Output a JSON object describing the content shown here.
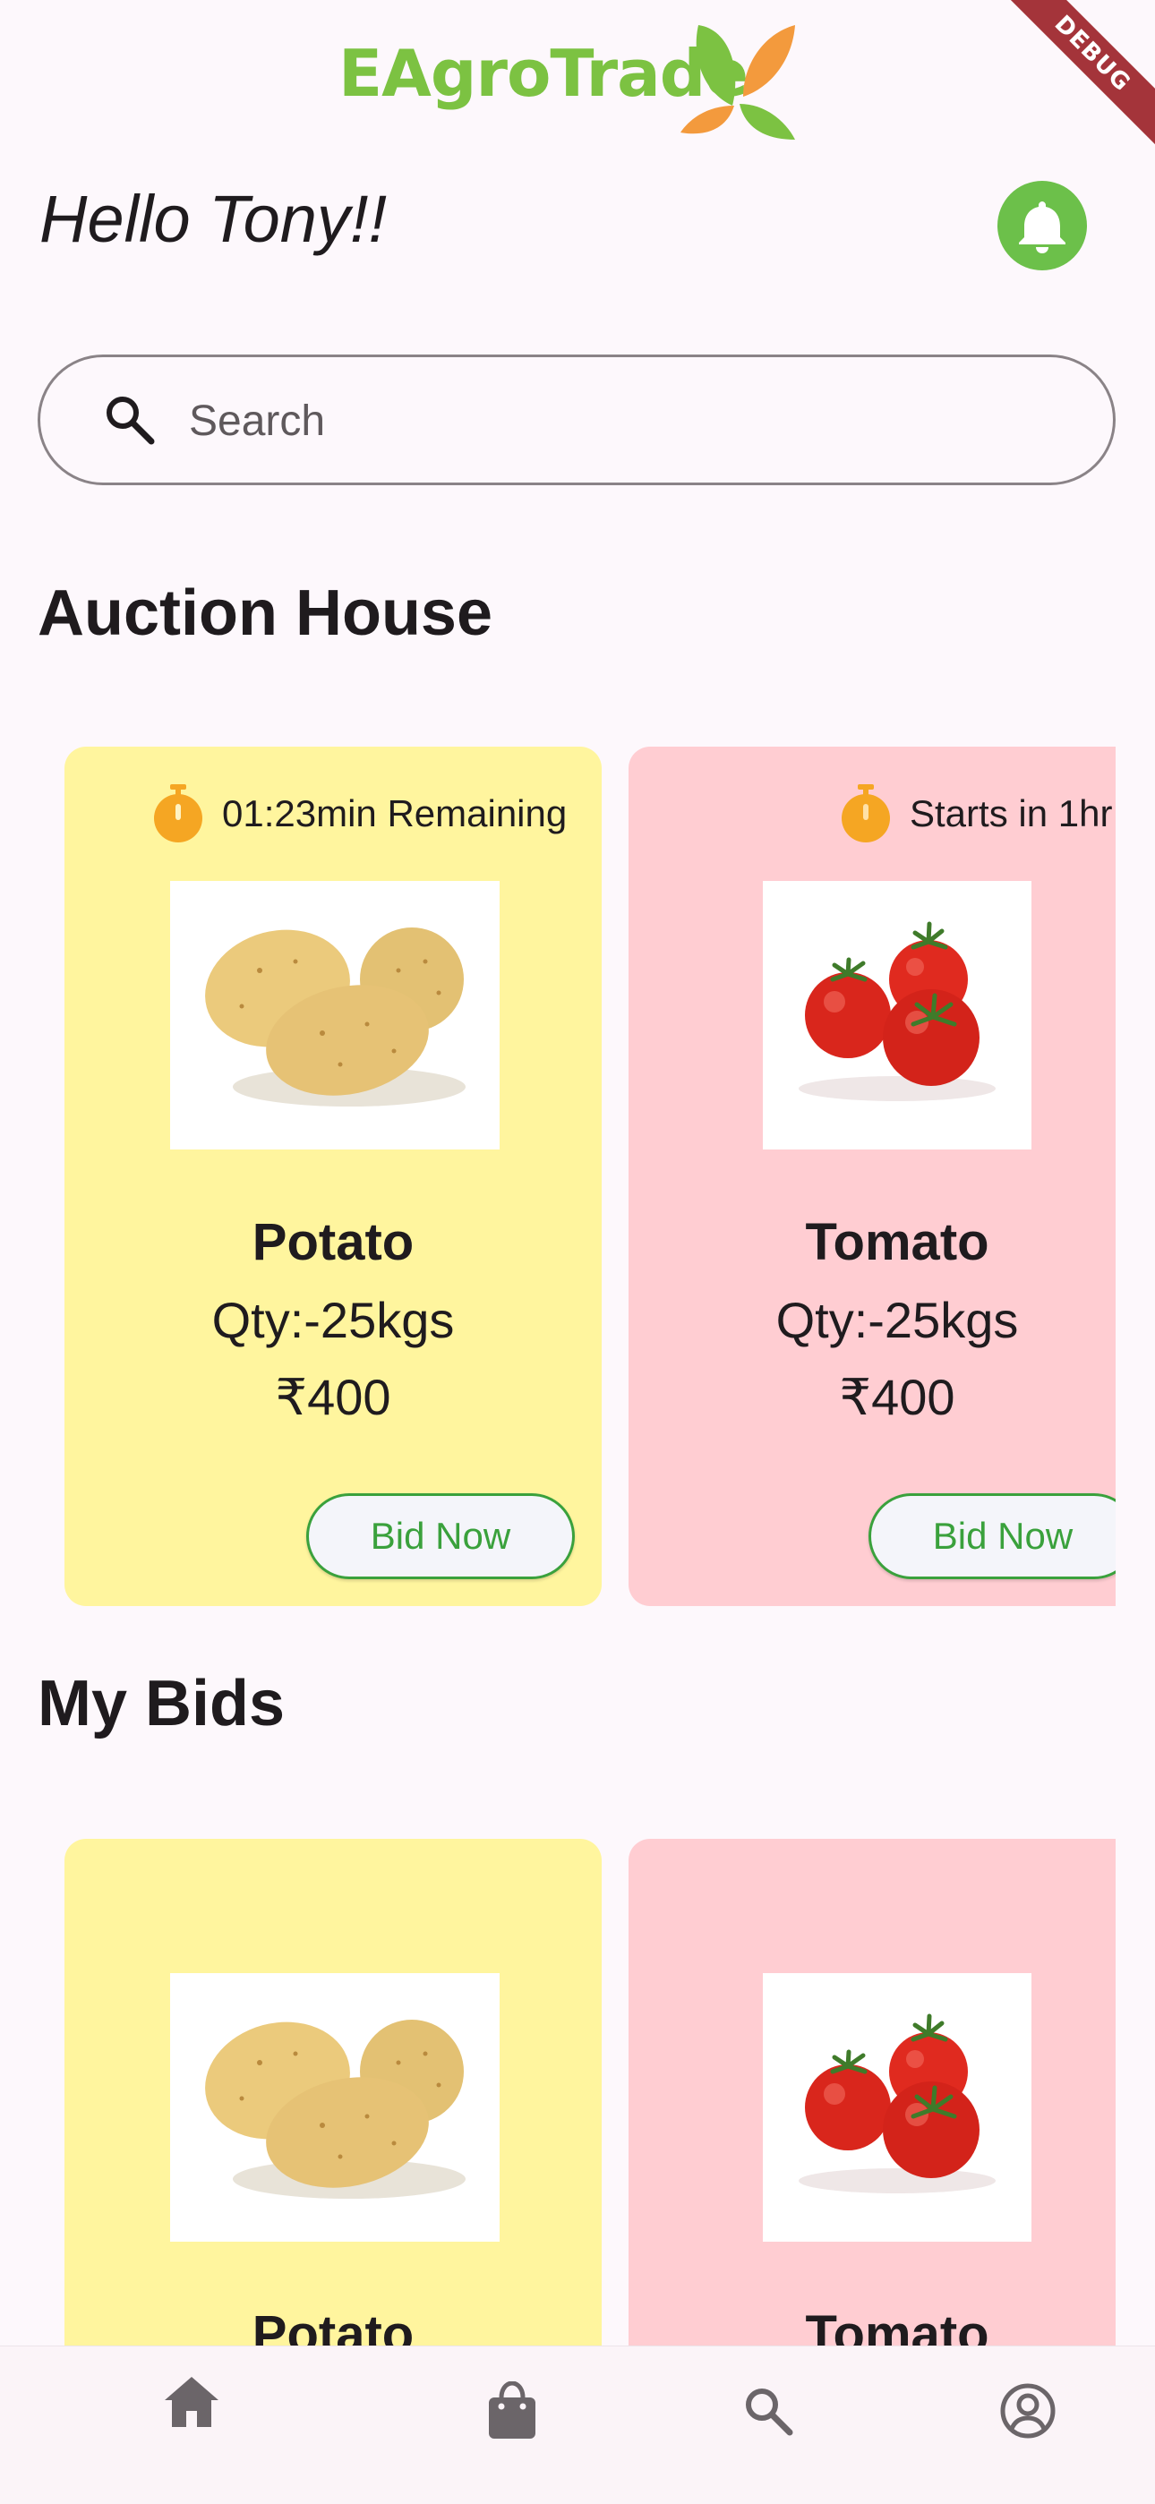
{
  "app": {
    "logo_text": "EAgroTrade",
    "debug_label": "DEBUG",
    "brand_green": "#7cc242",
    "brand_orange": "#f39a3d"
  },
  "header": {
    "greeting": "Hello Tony!!",
    "notification_icon": "bell-icon"
  },
  "search": {
    "placeholder": "Search",
    "value": "",
    "icon": "search-icon"
  },
  "auction_house": {
    "title": "Auction House",
    "cards": [
      {
        "timer": "01:23min Remaining",
        "image": "potato",
        "name": "Potato",
        "qty": "Qty:-25kgs",
        "price": "₹400",
        "button": "Bid Now",
        "color": "#fff59e"
      },
      {
        "timer": "Starts in 1hr",
        "image": "tomato",
        "name": "Tomato",
        "qty": "Qty:-25kgs",
        "price": "₹400",
        "button": "Bid Now",
        "color": "#ffcdd2"
      }
    ]
  },
  "my_bids": {
    "title": "My Bids",
    "cards": [
      {
        "image": "potato",
        "name": "Potato",
        "color": "#fff59e"
      },
      {
        "image": "tomato",
        "name": "Tomato",
        "color": "#ffcdd2"
      }
    ]
  },
  "bottom_nav": {
    "items": [
      {
        "icon": "home-icon"
      },
      {
        "icon": "shopping-bag-icon"
      },
      {
        "icon": "search-icon"
      },
      {
        "icon": "account-circle-icon"
      }
    ]
  }
}
